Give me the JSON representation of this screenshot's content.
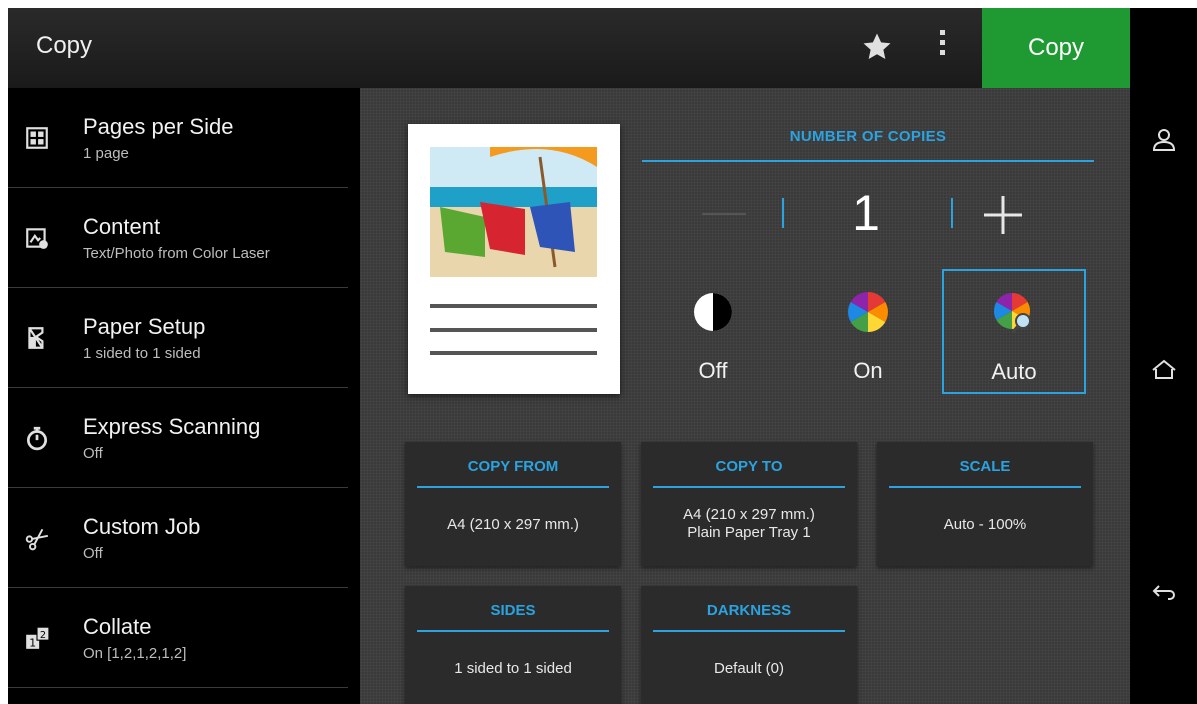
{
  "header": {
    "title": "Copy",
    "copy_button": "Copy",
    "star_icon": "star-icon",
    "menu_icon": "kebab-menu-icon"
  },
  "sidebar": {
    "items": [
      {
        "label": "Pages per Side",
        "value": "1 page",
        "icon": "pages-per-side-icon"
      },
      {
        "label": "Content",
        "value": "Text/Photo from Color Laser",
        "icon": "content-icon"
      },
      {
        "label": "Paper Setup",
        "value": "1 sided to 1 sided",
        "icon": "paper-setup-icon"
      },
      {
        "label": "Express Scanning",
        "value": "Off",
        "icon": "stopwatch-icon"
      },
      {
        "label": "Custom Job",
        "value": "Off",
        "icon": "scissors-icon"
      },
      {
        "label": "Collate",
        "value": "On [1,2,1,2,1,2]",
        "icon": "collate-icon"
      }
    ]
  },
  "copies": {
    "title": "NUMBER OF COPIES",
    "count": "1"
  },
  "color_mode": {
    "options": [
      {
        "label": "Off",
        "icon": "half-contrast-icon"
      },
      {
        "label": "On",
        "icon": "color-wheel-icon"
      },
      {
        "label": "Auto",
        "icon": "auto-color-icon"
      }
    ],
    "selected": "Auto"
  },
  "tiles": {
    "copy_from": {
      "title": "COPY FROM",
      "value": "A4 (210 x 297 mm.)"
    },
    "copy_to": {
      "title": "COPY TO",
      "value_line1": "A4 (210 x 297 mm.)",
      "value_line2": "Plain Paper Tray 1"
    },
    "scale": {
      "title": "SCALE",
      "value": "Auto - 100%"
    },
    "sides": {
      "title": "SIDES",
      "value": "1 sided to 1 sided"
    },
    "darkness": {
      "title": "DARKNESS",
      "value": "Default (0)"
    }
  },
  "right_nav": {
    "icons": [
      "user-icon",
      "home-icon",
      "back-icon"
    ]
  },
  "colors": {
    "accent": "#2aa3e0",
    "copy_button": "#1f9a33",
    "background": "#3a3a3a"
  }
}
